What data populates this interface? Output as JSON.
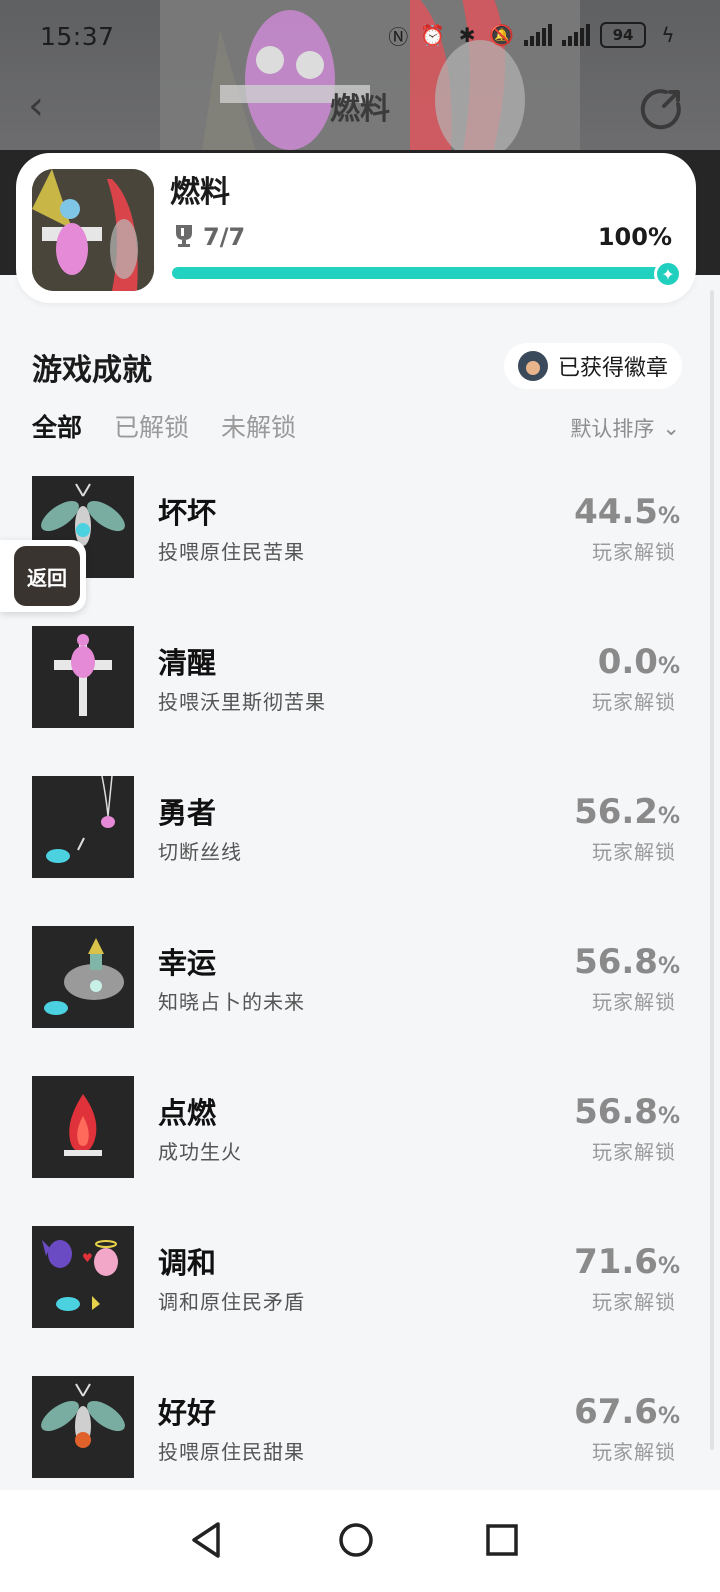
{
  "status_bar": {
    "time": "15:37",
    "battery": "94"
  },
  "nav": {
    "title": "燃料"
  },
  "game": {
    "name": "燃料",
    "progress_count": "7/7",
    "progress_pct": "100%",
    "progress_fraction": 1.0
  },
  "section": {
    "title": "游戏成就",
    "badge_button": "已获得徽章",
    "sort_label": "默认排序"
  },
  "tabs": [
    "全部",
    "已解锁",
    "未解锁"
  ],
  "achievements": [
    {
      "name": "坏坏",
      "desc": "投喂原住民苦果",
      "pct": "44.5",
      "unit": "%",
      "label": "玩家解锁"
    },
    {
      "name": "清醒",
      "desc": "投喂沃里斯彻苦果",
      "pct": "0.0",
      "unit": "%",
      "label": "玩家解锁"
    },
    {
      "name": "勇者",
      "desc": "切断丝线",
      "pct": "56.2",
      "unit": "%",
      "label": "玩家解锁"
    },
    {
      "name": "幸运",
      "desc": "知晓占卜的未来",
      "pct": "56.8",
      "unit": "%",
      "label": "玩家解锁"
    },
    {
      "name": "点燃",
      "desc": "成功生火",
      "pct": "56.8",
      "unit": "%",
      "label": "玩家解锁"
    },
    {
      "name": "调和",
      "desc": "调和原住民矛盾",
      "pct": "71.6",
      "unit": "%",
      "label": "玩家解锁"
    },
    {
      "name": "好好",
      "desc": "投喂原住民甜果",
      "pct": "67.6",
      "unit": "%",
      "label": "玩家解锁"
    }
  ],
  "float_back": {
    "label": "返回"
  },
  "colors": {
    "accent": "#22d2c0",
    "page_bg": "#f4f6f8"
  }
}
